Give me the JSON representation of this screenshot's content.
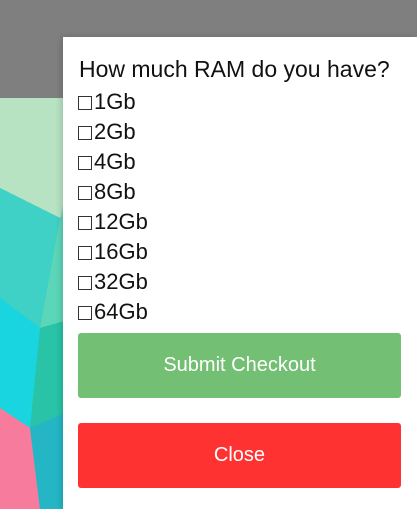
{
  "dialog": {
    "question": "How much RAM do you have?",
    "options": [
      {
        "label": "1Gb",
        "checked": false
      },
      {
        "label": "2Gb",
        "checked": false
      },
      {
        "label": "4Gb",
        "checked": false
      },
      {
        "label": "8Gb",
        "checked": false
      },
      {
        "label": "12Gb",
        "checked": false
      },
      {
        "label": "16Gb",
        "checked": false
      },
      {
        "label": "32Gb",
        "checked": false
      },
      {
        "label": "64Gb",
        "checked": false
      }
    ],
    "submit_label": "Submit Checkout",
    "close_label": "Close"
  },
  "colors": {
    "submit": "#73bf73",
    "close": "#ff3232",
    "backdrop_gray": "#7f7f7f"
  },
  "icons": {
    "checkbox": "checkbox-empty-icon"
  }
}
